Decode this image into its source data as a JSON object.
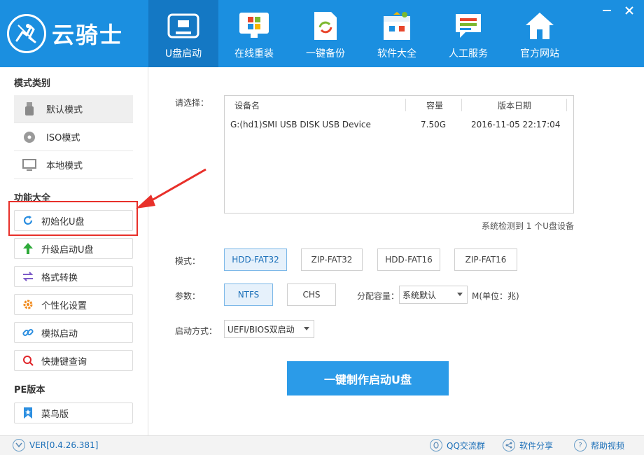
{
  "app": {
    "name": "云骑士"
  },
  "nav": [
    {
      "label": "U盘启动",
      "active": true
    },
    {
      "label": "在线重装"
    },
    {
      "label": "一键备份"
    },
    {
      "label": "软件大全"
    },
    {
      "label": "人工服务"
    },
    {
      "label": "官方网站"
    }
  ],
  "sidebar": {
    "mode_title": "模式类别",
    "modes": [
      {
        "label": "默认模式",
        "icon": "usb-icon"
      },
      {
        "label": "ISO模式",
        "icon": "disc-icon"
      },
      {
        "label": "本地模式",
        "icon": "monitor-icon"
      }
    ],
    "func_title": "功能大全",
    "funcs": [
      {
        "label": "初始化U盘",
        "icon": "refresh-icon"
      },
      {
        "label": "升级启动U盘",
        "icon": "arrow-up-icon"
      },
      {
        "label": "格式转换",
        "icon": "swap-icon"
      },
      {
        "label": "个性化设置",
        "icon": "gear-icon"
      },
      {
        "label": "模拟启动",
        "icon": "link-icon"
      },
      {
        "label": "快捷键查询",
        "icon": "search-icon"
      }
    ],
    "pe_title": "PE版本",
    "pe": [
      {
        "label": "菜鸟版",
        "icon": "bookmark-icon"
      }
    ]
  },
  "main": {
    "select_label": "请选择：",
    "table": {
      "headers": [
        "设备名",
        "容量",
        "版本日期"
      ],
      "rows": [
        [
          "G:(hd1)SMI USB DISK USB Device",
          "7.50G",
          "2016-11-05 22:17:04"
        ]
      ]
    },
    "detect_text": "系统检测到 1 个U盘设备",
    "mode_label": "模式：",
    "modes": [
      "HDD-FAT32",
      "ZIP-FAT32",
      "HDD-FAT16",
      "ZIP-FAT16"
    ],
    "param_label": "参数：",
    "params": [
      "NTFS",
      "CHS"
    ],
    "alloc_label": "分配容量：",
    "alloc_value": "系统默认",
    "alloc_unit": "M(单位：兆)",
    "boot_label": "启动方式：",
    "boot_value": "UEFI/BIOS双启动",
    "make_button": "一键制作启动U盘"
  },
  "footer": {
    "version": "VER[0.4.26.381]",
    "qq": "QQ交流群",
    "share": "软件分享",
    "help": "帮助视频"
  },
  "colors": {
    "header": "#1b8fe0",
    "active_tab": "#1478c4",
    "primary_button": "#2b9be8",
    "highlight": "#e8302a"
  }
}
